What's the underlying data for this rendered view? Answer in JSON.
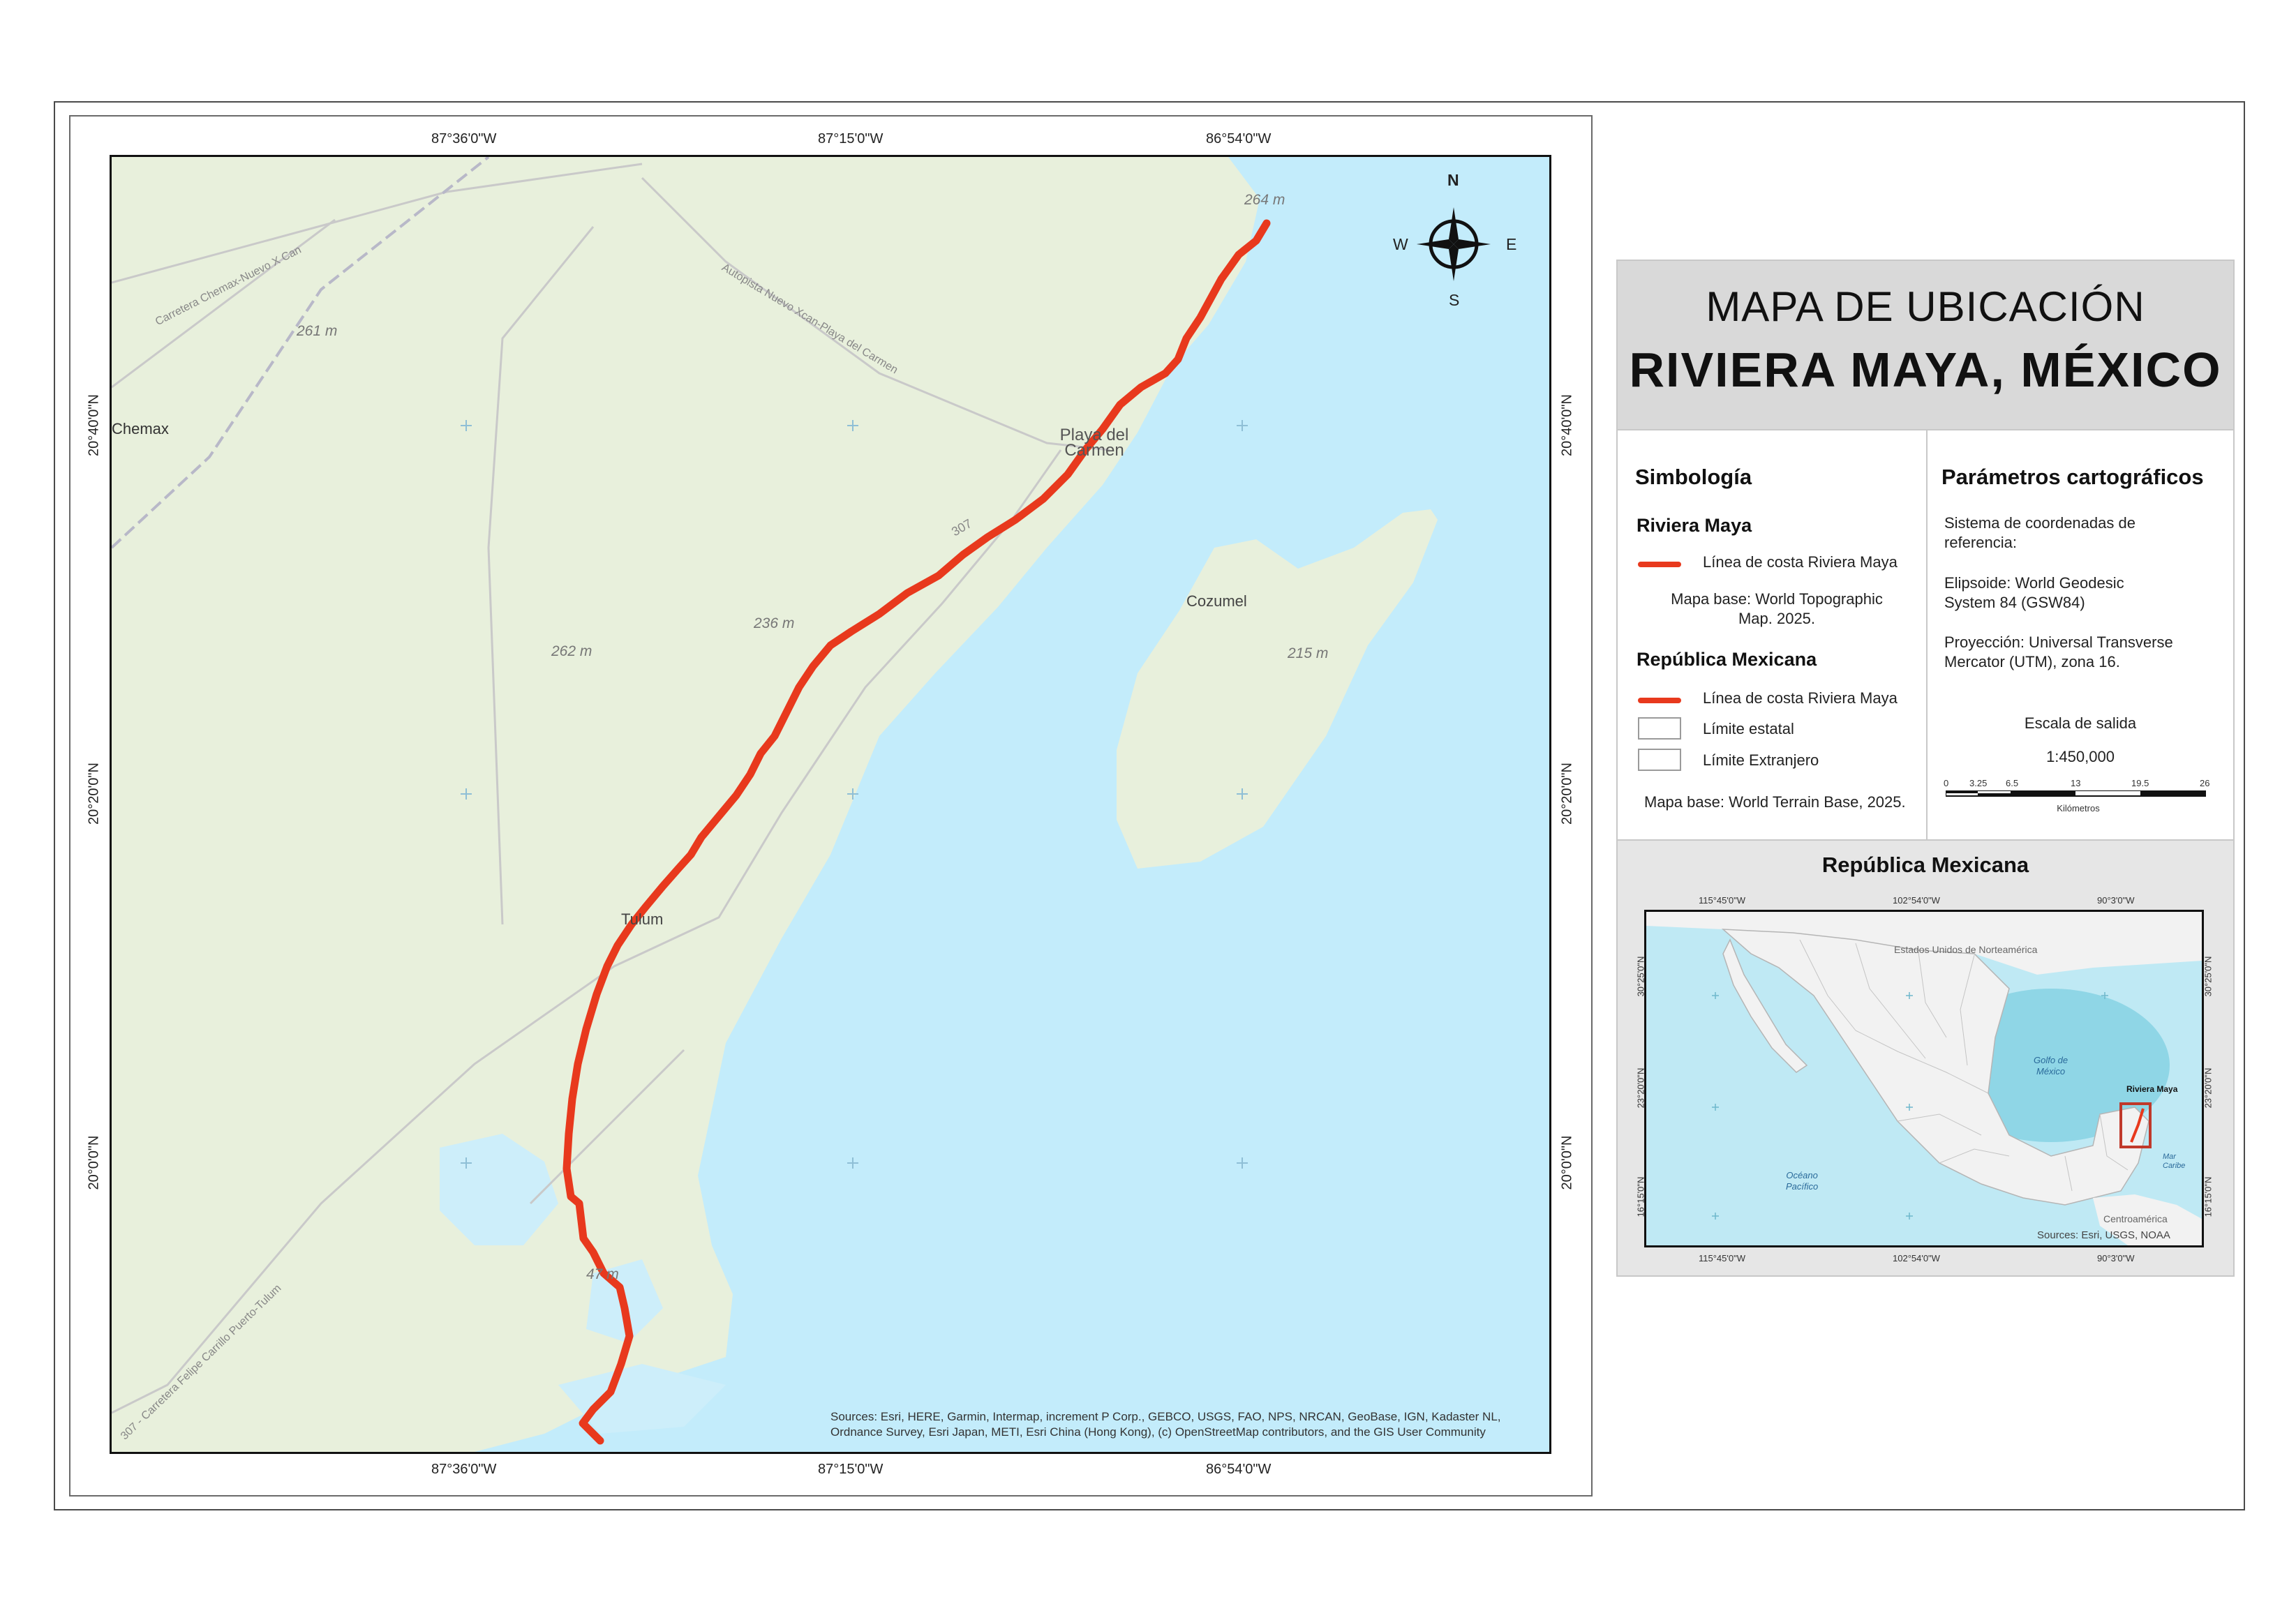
{
  "title": {
    "line1": "MAPA DE UBICACIÓN",
    "line2": "RIVIERA MAYA, MÉXICO"
  },
  "main_map": {
    "lon_labels": [
      "87°36'0\"W",
      "87°15'0\"W",
      "86°54'0\"W"
    ],
    "lat_labels": [
      "20°40'0\"N",
      "20°20'0\"N",
      "20°0'0\"N"
    ],
    "places": {
      "chemax": "Chemax",
      "playa_line1": "Playa del",
      "playa_line2": "Carmen",
      "cozumel": "Cozumel",
      "tulum": "Tulum"
    },
    "elevations": [
      "264 m",
      "261 m",
      "236 m",
      "262 m",
      "215 m",
      "47 m"
    ],
    "roads": {
      "chemax_road": "Carretera Chemax-Nuevo X Can",
      "autopista": "Autopista Nuevo Xcan-Playa del Carmen",
      "route_307": "307",
      "tulum_road": "307 - Carretera Felipe Carrillo Puerto-Tulum"
    },
    "north_arrow": {
      "n": "N",
      "s": "S",
      "e": "E",
      "w": "W"
    },
    "attribution_line1": "Sources: Esri, HERE, Garmin, Intermap, increment P Corp., GEBCO, USGS, FAO, NPS, NRCAN, GeoBase, IGN, Kadaster NL,",
    "attribution_line2": "Ordnance Survey, Esri Japan, METI, Esri China (Hong Kong), (c) OpenStreetMap contributors, and the GIS User Community",
    "colors": {
      "land": "#e8f0dc",
      "water": "#c3ecfb",
      "coastline": "#e8391d"
    }
  },
  "legend": {
    "title": "Simbología",
    "section1": "Riviera Maya",
    "item1": "Línea de costa Riviera Maya",
    "basemap1_line1": "Mapa base: World Topographic",
    "basemap1_line2": "Map. 2025.",
    "section2": "República Mexicana",
    "item2": "Línea de costa Riviera Maya",
    "item3": "Límite estatal",
    "item4": "Límite Extranjero",
    "basemap2": "Mapa base: World Terrain Base, 2025."
  },
  "params": {
    "title": "Parámetros cartográficos",
    "crs_line1": "Sistema de coordenadas de",
    "crs_line2": "referencia:",
    "ellipsoid_line1": "Elipsoide: World Geodesic",
    "ellipsoid_line2": "System 84 (GSW84)",
    "projection_line1": "Proyección: Universal Transverse",
    "projection_line2": "Mercator (UTM), zona 16.",
    "scale_label": "Escala de salida",
    "scale_value": "1:450,000",
    "scalebar_ticks": [
      "0",
      "3.25",
      "6.5",
      "13",
      "19.5",
      "26"
    ],
    "scalebar_unit": "Kilómetros"
  },
  "inset": {
    "title": "República Mexicana",
    "top_labels": [
      "115°45'0\"W",
      "102°54'0\"W",
      "90°3'0\"W"
    ],
    "bottom_labels": [
      "115°45'0\"W",
      "102°54'0\"W",
      "90°3'0\"W"
    ],
    "left_labels": [
      "30°25'0\"N",
      "23°20'0\"N",
      "16°15'0\"N"
    ],
    "right_labels": [
      "30°25'0\"N",
      "23°20'0\"N",
      "16°15'0\"N"
    ],
    "usa": "Estados Unidos de Norteamérica",
    "gulf_line1": "Golfo de",
    "gulf_line2": "México",
    "pacific_line1": "Océano",
    "pacific_line2": "Pacífico",
    "riviera": "Riviera Maya",
    "caribe": "Mar Caribe",
    "central": "Centroamérica",
    "sources": "Sources: Esri, USGS, NOAA",
    "colors": {
      "land": "#f2f2f2",
      "water": "#bfe9f4",
      "highlight": "#c0392b"
    }
  }
}
